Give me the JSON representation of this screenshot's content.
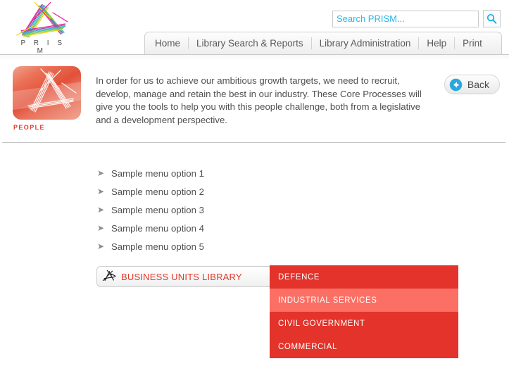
{
  "brand": {
    "name": "PRISM",
    "logo_icon": "prism-triangle-logo",
    "wordmark": "P R I S M"
  },
  "search": {
    "placeholder": "Search PRISM...",
    "value": "",
    "button_icon": "search-icon",
    "accent_color": "#29b6e8"
  },
  "nav": {
    "tabs": [
      {
        "label": "Home"
      },
      {
        "label": "Library Search & Reports"
      },
      {
        "label": "Library Administration"
      },
      {
        "label": "Help"
      },
      {
        "label": "Print"
      }
    ]
  },
  "intro": {
    "banner_icon": "people-prism-tile",
    "banner_label": "PEOPLE",
    "banner_color": "#e2513a",
    "body": "In order for us to achieve our ambitious growth targets, we need to recruit, develop, manage and retain the best in our industry.  These Core Processes will give you the tools to help you with this people challenge, both from a legislative and a development perspective.",
    "back_button": {
      "label": "Back",
      "icon": "arrow-left-circle-icon",
      "icon_color": "#29a8e0"
    }
  },
  "menu": {
    "bullet_icon": "arrow-right-bullet-icon",
    "items": [
      {
        "label": "Sample menu option 1"
      },
      {
        "label": "Sample menu option 2"
      },
      {
        "label": "Sample menu option 3"
      },
      {
        "label": "Sample menu option 4"
      },
      {
        "label": "Sample menu option 5"
      }
    ]
  },
  "business_units": {
    "bar_icon": "prism-triangle-small-icon",
    "bar_label": "BUSINESS UNITS LIBRARY",
    "bar_label_color": "#e0392c",
    "dropdown_color": "#e3332a",
    "dropdown_highlight_color": "#fb6f64",
    "options": [
      {
        "label": "DEFENCE",
        "selected": false
      },
      {
        "label": "INDUSTRIAL SERVICES",
        "selected": true
      },
      {
        "label": "CIVIL GOVERNMENT",
        "selected": false
      },
      {
        "label": "COMMERCIAL",
        "selected": false
      }
    ]
  }
}
